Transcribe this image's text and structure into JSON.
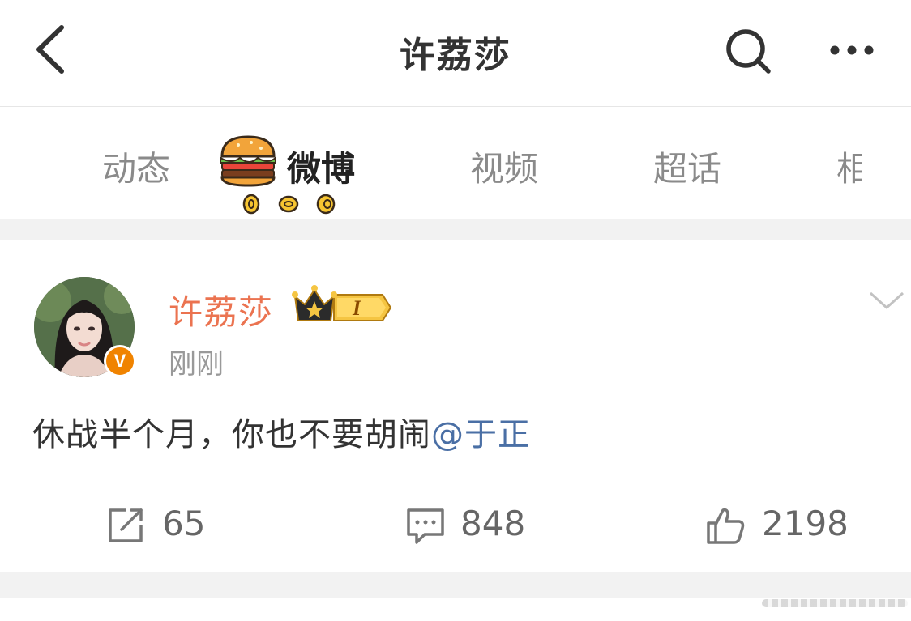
{
  "header": {
    "title": "许荔莎"
  },
  "tabs": [
    {
      "label": "动态"
    },
    {
      "label": "微博"
    },
    {
      "label": "视频"
    },
    {
      "label": "超话"
    },
    {
      "label": "相"
    }
  ],
  "post": {
    "username": "许荔莎",
    "badge_level": "I",
    "time": "刚刚",
    "verified_mark": "V",
    "text": "休战半个月，你也不要胡闹",
    "mention": "@于正",
    "actions": {
      "repost": "65",
      "comment": "848",
      "like": "2198"
    }
  },
  "colors": {
    "username": "#eb7350",
    "mention": "#4a6fa5",
    "verified": "#f08300",
    "badge_gold": "#f5c542"
  }
}
